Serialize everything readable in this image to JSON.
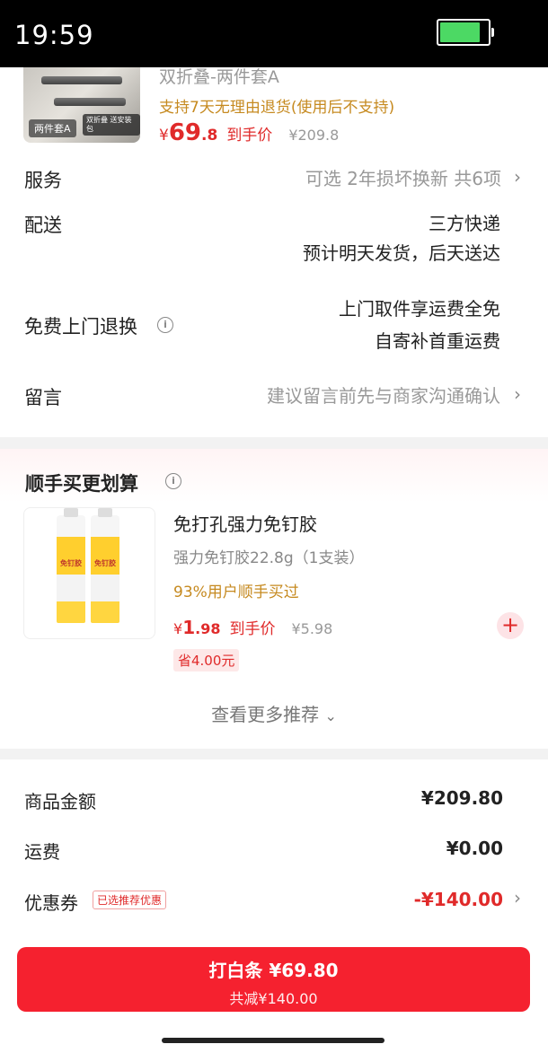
{
  "status_bar": {
    "time": "19:59",
    "battery_level": 0.85,
    "battery_color": "#4cd964"
  },
  "product": {
    "title": "双折叠-两件套A",
    "return_policy": "支持7天无理由退货(使用后不支持)",
    "price_yen": "¥",
    "price_int": "69",
    "price_dec": ".8",
    "price_label": "到手价",
    "original_price": "¥209.8",
    "thumb_tag": "两件套A",
    "thumb_tag2": "双折叠 送安装包"
  },
  "details": {
    "service": {
      "label": "服务",
      "value": "可选 2年损坏换新 共6项"
    },
    "delivery": {
      "label": "配送",
      "line1": "三方快递",
      "line2": "预计明天发货，后天送达"
    },
    "free_return": {
      "label": "免费上门退换",
      "line1": "上门取件享运费全免",
      "line2": "自寄补首重运费"
    },
    "message": {
      "label": "留言",
      "placeholder": "建议留言前先与商家沟通确认"
    }
  },
  "recommend": {
    "title": "顺手买更划算",
    "item": {
      "name": "免打孔强力免钉胶",
      "spec": "强力免钉胶22.8g（1支装）",
      "buy_rate": "93%用户顺手买过",
      "price_yen": "¥",
      "price_int": "1",
      "price_dec": ".98",
      "price_label": "到手价",
      "original_price": "¥5.98",
      "save": "省4.00元",
      "tube_label": "免钉胶"
    },
    "more_label": "查看更多推荐"
  },
  "totals": {
    "goods": {
      "label": "商品金额",
      "value": "¥209.80"
    },
    "shipping": {
      "label": "运费",
      "value": "¥0.00"
    },
    "coupon": {
      "label": "优惠券",
      "tag": "已选推荐优惠",
      "value": "-¥140.00"
    }
  },
  "pay_button": {
    "line1": "打白条 ¥69.80",
    "line2": "共减¥140.00"
  },
  "colors": {
    "accent_red": "#e02a2a",
    "button_red": "#f5212f",
    "gold": "#c68a20"
  }
}
